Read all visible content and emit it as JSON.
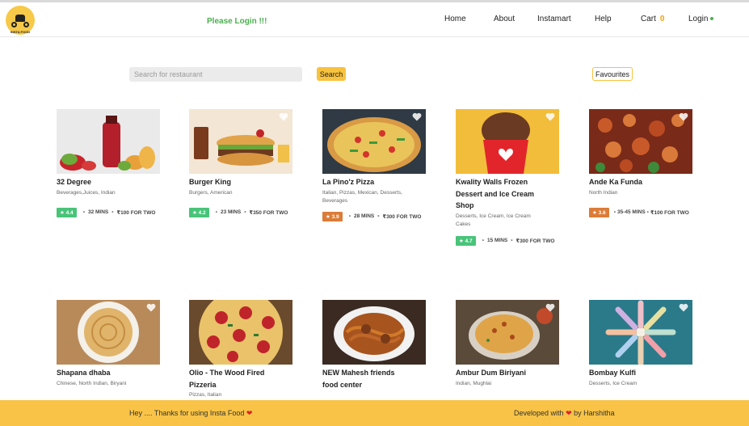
{
  "header": {
    "logo_text": "INSTA FOOD",
    "login_message": "Please Login !!!",
    "nav": {
      "home": "Home",
      "about": "About",
      "instamart": "Instamart",
      "help": "Help",
      "cart": "Cart",
      "cart_count": "0",
      "login": "Login"
    }
  },
  "search": {
    "placeholder": "Search for restaurant",
    "button": "Search",
    "favourites": "Favourites"
  },
  "colors": {
    "accent": "#f7c23e",
    "rating_green": "#48c479",
    "rating_orange": "#db7c38",
    "login_green": "#4caf50"
  },
  "restaurants": [
    {
      "name": "32 Degree",
      "cuisines": "Beverages,Juices, Indian",
      "rating": "4.4",
      "rating_color": "#48c479",
      "time": "32 MINS",
      "cost": "₹100 FOR TWO"
    },
    {
      "name": "Burger King",
      "cuisines": "Burgers, American",
      "rating": "4.2",
      "rating_color": "#48c479",
      "time": "23 MINS",
      "cost": "₹350 FOR TWO"
    },
    {
      "name": "La Pino'z Pizza",
      "cuisines": "Italian, Pizzas, Mexican, Desserts, Beverages",
      "rating": "3.9",
      "rating_color": "#db7c38",
      "time": "28 MINS",
      "cost": "₹300 FOR TWO"
    },
    {
      "name": "Kwality Walls Frozen Dessert and Ice Cream Shop",
      "cuisines": "Desserts, Ice Cream, Ice Cream Cakes",
      "rating": "4.7",
      "rating_color": "#48c479",
      "time": "15 MINS",
      "cost": "₹300 FOR TWO"
    },
    {
      "name": "Ande Ka Funda",
      "cuisines": "North Indian",
      "rating": "3.6",
      "rating_color": "#db7c38",
      "time": "35-45 MINS",
      "cost": "₹100 FOR TWO"
    },
    {
      "name": "Shapana dhaba",
      "cuisines": "Chinese, North Indian, Biryani"
    },
    {
      "name": "Olio - The Wood Fired Pizzeria",
      "cuisines": "Pizzas, Italian"
    },
    {
      "name": "NEW Mahesh friends food center",
      "cuisines": ""
    },
    {
      "name": "Ambur Dum Biriyani",
      "cuisines": "Indian, Mughlai"
    },
    {
      "name": "Bombay Kulfi",
      "cuisines": "Desserts, Ice Cream"
    }
  ],
  "footer": {
    "left_text": "Hey .... Thanks for using Insta Food",
    "right_prefix": "Developed with",
    "right_suffix": "by Harshitha",
    "heart_glyph": "❤"
  }
}
